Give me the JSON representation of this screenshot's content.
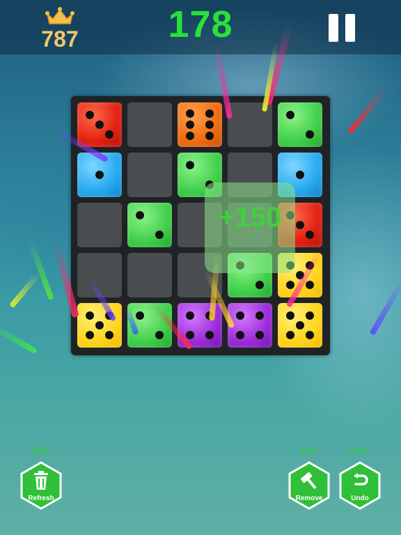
{
  "header": {
    "best_score": "787",
    "current_score": "178",
    "crown_icon": "crown-icon",
    "pause_icon": "pause-icon"
  },
  "board": {
    "rows": [
      [
        {
          "color": "red",
          "value": 3
        },
        {
          "color": "empty"
        },
        {
          "color": "orange",
          "value": 6
        },
        {
          "color": "empty"
        },
        {
          "color": "green",
          "value": 2
        }
      ],
      [
        {
          "color": "blue",
          "value": 1
        },
        {
          "color": "empty"
        },
        {
          "color": "green",
          "value": 2
        },
        {
          "color": "empty"
        },
        {
          "color": "blue",
          "value": 1
        }
      ],
      [
        {
          "color": "empty"
        },
        {
          "color": "green",
          "value": 2
        },
        {
          "color": "empty"
        },
        {
          "color": "empty"
        },
        {
          "color": "red",
          "value": 3
        }
      ],
      [
        {
          "color": "empty"
        },
        {
          "color": "empty"
        },
        {
          "color": "empty"
        },
        {
          "color": "green",
          "value": 2
        },
        {
          "color": "yellow",
          "value": 5
        }
      ],
      [
        {
          "color": "yellow",
          "value": 5
        },
        {
          "color": "green",
          "value": 2
        },
        {
          "color": "purple",
          "value": 4
        },
        {
          "color": "purple",
          "value": 4
        },
        {
          "color": "yellow",
          "value": 5
        }
      ]
    ]
  },
  "popup": {
    "text": "+150"
  },
  "buttons": {
    "refresh": {
      "label": "Refresh",
      "ads": "ADS",
      "icon": "trash-icon"
    },
    "remove": {
      "label": "Remove",
      "ads": "ADS",
      "icon": "hammer-icon"
    },
    "undo": {
      "label": "Undo",
      "ads": "ADS",
      "icon": "undo-arrow-icon"
    }
  },
  "colors": {
    "score_green": "#26e23a",
    "best_gold": "#f3c66c",
    "button_green": "#2fbf38"
  }
}
